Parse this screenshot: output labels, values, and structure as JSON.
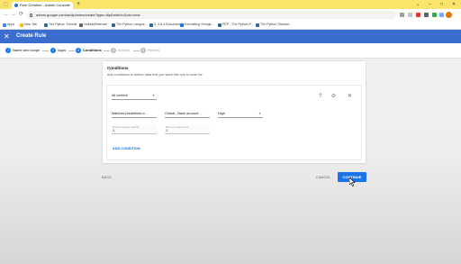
{
  "browser": {
    "tab_title": "Rule Creation - Admin Console",
    "tab_close": "×",
    "new_tab": "+",
    "window_controls": [
      "⌄",
      "–",
      "□",
      "✕"
    ],
    "url": "admin.google.com/ac/dp/rules/create?type=dlp&ruleId=&ctx=new",
    "nav": [
      "←",
      "→",
      "⟳"
    ],
    "bookmarks": [
      "Apps",
      "New Tab",
      "The Python Tutorial",
      "HolidayRelevant",
      "The Python Langua...",
      "3. 3.6.4 Documentati...",
      "Formatting Strings...",
      "PEP - The Python P...",
      "The Python Standar..."
    ],
    "colors": {
      "frame": "#fbe46a",
      "profile": "#e37400"
    }
  },
  "app": {
    "close_icon": "✕",
    "title": "Create Rule",
    "accent": "#3b6dcf",
    "steps": [
      {
        "label": "Name and scope",
        "state": "done",
        "marker": "✓"
      },
      {
        "label": "Apps",
        "state": "done",
        "marker": "✓"
      },
      {
        "label": "Conditions",
        "state": "active",
        "marker": "3"
      },
      {
        "label": "Actions",
        "state": "todo",
        "marker": "4"
      },
      {
        "label": "Review",
        "state": "todo",
        "marker": "5"
      }
    ]
  },
  "conditions": {
    "title": "Conditions",
    "description": "Add conditions to define data that you want this rule to scan for",
    "scope_select": "All content",
    "help_icon": "?",
    "remove_icon": "⊖",
    "close_icon": "✕",
    "match_select": "Matches predefined d...",
    "type_select": "Global - Bank account ...",
    "likelihood_select": "High",
    "min_unique_label": "Minimum unique matched",
    "min_unique_value": "1",
    "min_count_label": "Minimum match count",
    "min_count_value": "1",
    "add_condition": "ADD CONDITION"
  },
  "footer": {
    "back": "BACK",
    "cancel": "CANCEL",
    "continue": "CONTINUE"
  }
}
